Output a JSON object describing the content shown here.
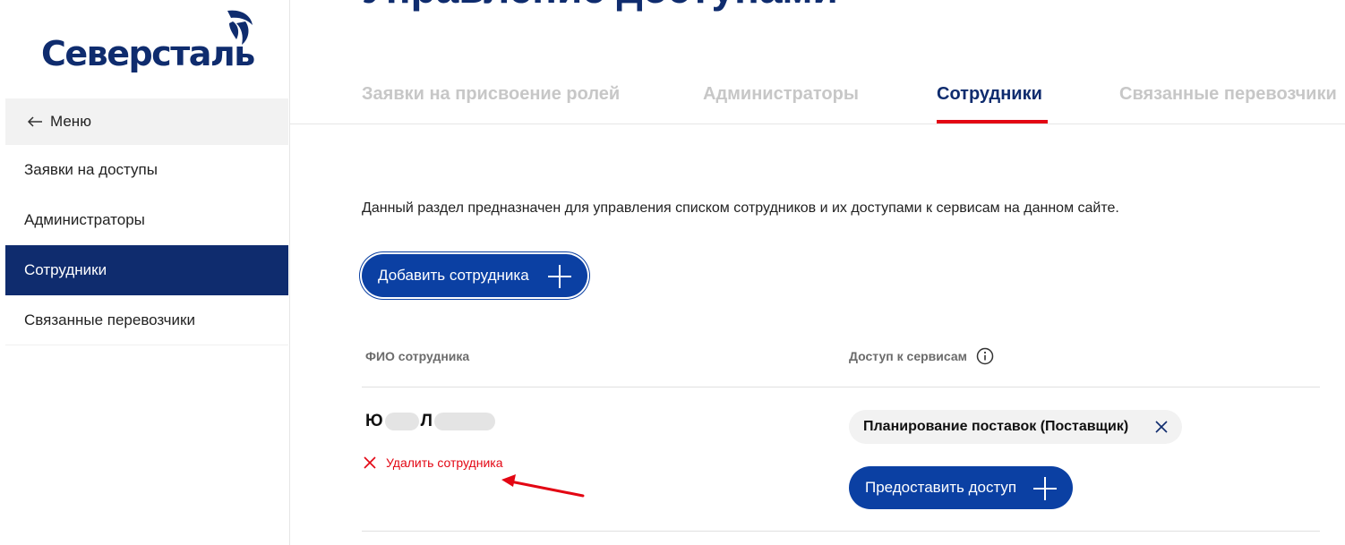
{
  "brand": {
    "name": "Северсталь",
    "color": "#0f2c6e"
  },
  "page": {
    "title": "Управление доступами"
  },
  "sidebar": {
    "back_label": "Меню",
    "items": [
      {
        "label": "Заявки на доступы",
        "active": false
      },
      {
        "label": "Администраторы",
        "active": false
      },
      {
        "label": "Сотрудники",
        "active": true
      },
      {
        "label": "Связанные перевозчики",
        "active": false
      }
    ]
  },
  "tabs": [
    {
      "label": "Заявки на присвоение ролей",
      "active": false
    },
    {
      "label": "Администраторы",
      "active": false
    },
    {
      "label": "Сотрудники",
      "active": true
    },
    {
      "label": "Связанные перевозчики",
      "active": false
    }
  ],
  "main": {
    "description": "Данный раздел предназначен для управления списком сотрудников и их доступами к сервисам на данном сайте.",
    "add_button": "Добавить сотрудника",
    "columns": {
      "employee": "ФИО сотрудника",
      "access": "Доступ к сервисам"
    },
    "employee": {
      "name_first_initial": "Ю",
      "name_second_initial": "Л",
      "delete_label": "Удалить сотрудника",
      "services": [
        "Планирование поставок (Поставщик)"
      ],
      "grant_button": "Предоставить доступ"
    }
  },
  "colors": {
    "accent": "#0b40a3",
    "navy": "#0f2c6e",
    "danger": "#e30613",
    "muted": "#c7c7c7"
  }
}
